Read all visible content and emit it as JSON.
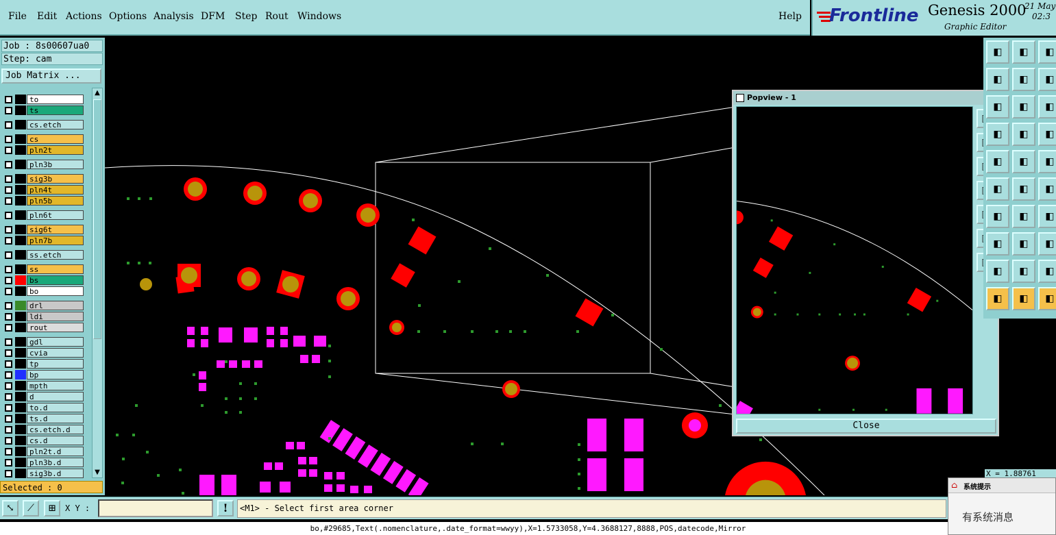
{
  "menu": {
    "file": "File",
    "edit": "Edit",
    "actions": "Actions",
    "options": "Options",
    "analysis": "Analysis",
    "dfm": "DFM",
    "step": "Step",
    "rout": "Rout",
    "windows": "Windows",
    "help": "Help"
  },
  "brand": {
    "logo": "Frontline",
    "product": "Genesis 2000",
    "subtitle": "Graphic Editor",
    "date": "21 May",
    "time": "02:3"
  },
  "job": {
    "job_label": "Job : 8s00607ua0",
    "step_label": "Step: cam",
    "matrix_button": "Job Matrix ..."
  },
  "layers": [
    {
      "name": "to",
      "color": "#ffffff"
    },
    {
      "name": "ts",
      "color": "#1aa87a"
    },
    {
      "name": "cs.etch",
      "color": "#b8e3e3"
    },
    {
      "name": "cs",
      "color": "#f5c04a"
    },
    {
      "name": "pln2t",
      "color": "#e2b72a"
    },
    {
      "name": "pln3b",
      "color": "#b8e3e3"
    },
    {
      "name": "sig3b",
      "color": "#f5c04a"
    },
    {
      "name": "pln4t",
      "color": "#e2b72a"
    },
    {
      "name": "pln5b",
      "color": "#e2b72a"
    },
    {
      "name": "pln6t",
      "color": "#b8e3e3"
    },
    {
      "name": "sig6t",
      "color": "#f5c04a"
    },
    {
      "name": "pln7b",
      "color": "#e2b72a"
    },
    {
      "name": "ss.etch",
      "color": "#b8e3e3"
    },
    {
      "name": "ss",
      "color": "#f5c04a"
    },
    {
      "name": "bs",
      "color": "#1aa87a"
    },
    {
      "name": "bo",
      "color": "#ffffff"
    },
    {
      "name": "drl",
      "color": "#c8c8c8"
    },
    {
      "name": "ldi",
      "color": "#c8c8c8"
    },
    {
      "name": "rout",
      "color": "#dcdcdc"
    },
    {
      "name": "gdl",
      "color": "#b8e3e3"
    },
    {
      "name": "cvia",
      "color": "#b8e3e3"
    },
    {
      "name": "tp",
      "color": "#b8e3e3"
    },
    {
      "name": "bp",
      "color": "#b8e3e3"
    },
    {
      "name": "mpth",
      "color": "#b8e3e3"
    },
    {
      "name": "d",
      "color": "#b8e3e3"
    },
    {
      "name": "to.d",
      "color": "#b8e3e3"
    },
    {
      "name": "ts.d",
      "color": "#b8e3e3"
    },
    {
      "name": "cs.etch.d",
      "color": "#b8e3e3"
    },
    {
      "name": "cs.d",
      "color": "#b8e3e3"
    },
    {
      "name": "pln2t.d",
      "color": "#b8e3e3"
    },
    {
      "name": "pln3b.d",
      "color": "#b8e3e3"
    },
    {
      "name": "sig3b.d",
      "color": "#b8e3e3"
    }
  ],
  "selected": "Selected : 0",
  "popview": {
    "title": "Popview - 1",
    "close_label": "Close"
  },
  "bottom": {
    "xy_label": "X Y :",
    "xy_value": "",
    "prompt": "<M1> - Select first area corner"
  },
  "status": "bo,#29685,Text(.nomenclature,.date_format=wwyy),X=1.5733058,Y=4.3688127,8888,POS,datecode,Mirror",
  "coord_readout": "X = 1.88761",
  "notice": {
    "title": "系统提示",
    "body": "有系统消息"
  }
}
